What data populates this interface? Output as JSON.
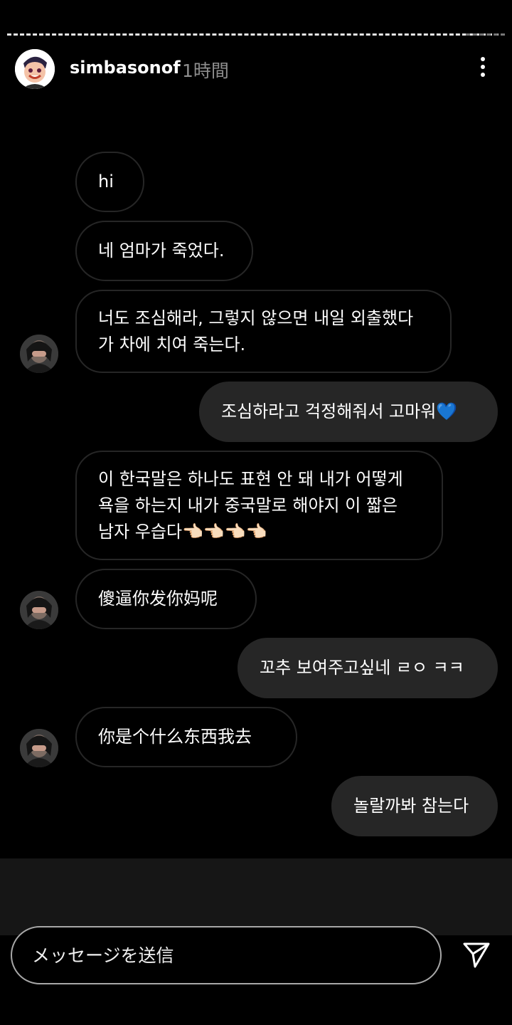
{
  "story": {
    "username": "simbasonof",
    "timestamp": "1時間",
    "progress": 0.93
  },
  "messages": [
    {
      "side": "received",
      "text": "hi"
    },
    {
      "side": "received",
      "text": "네 엄마가 죽었다."
    },
    {
      "side": "received",
      "text": "너도 조심해라, 그렇지 않으면 내일 외출했다\n가 차에 치여 죽는다."
    },
    {
      "side": "sent",
      "text": "조심하라고 걱정해줘서 고마워💙"
    },
    {
      "side": "received",
      "text": "이 한국말은 하나도 표현 안 돼 내가 어떻게\n욕을 하는지 내가 중국말로 해야지 이 짧은\n남자 우습다👈🏻👈🏻👈🏻👈🏻"
    },
    {
      "side": "received",
      "text": "傻逼你发你妈呢"
    },
    {
      "side": "sent",
      "text": "꼬추 보여주고싶네 ㄹㅇ ㅋㅋ"
    },
    {
      "side": "received",
      "text": "你是个什么东西我去"
    },
    {
      "side": "sent",
      "text": "놀랄까봐 참는다"
    }
  ],
  "composer": {
    "placeholder": "メッセージを送信"
  },
  "icons": {
    "more": "more-vertical-icon",
    "send": "send-icon"
  },
  "colors": {
    "background": "#000000",
    "sent_bubble": "#262626",
    "received_border": "#262626",
    "muted_text": "#8e8e8e"
  }
}
